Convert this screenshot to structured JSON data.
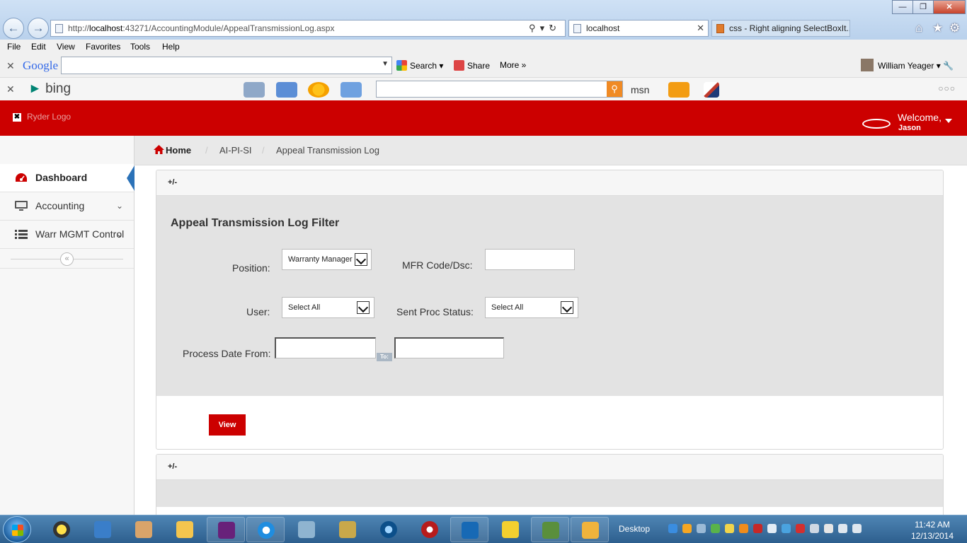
{
  "browser": {
    "address_prefix": "http://",
    "address_host": "localhost",
    "address_rest": ":43271/AccountingModule/AppealTransmissionLog.aspx",
    "tabs": [
      {
        "label": "localhost",
        "active": true
      },
      {
        "label": "css - Right aligning SelectBoxIt...",
        "active": false
      }
    ],
    "menu": [
      "File",
      "Edit",
      "View",
      "Favorites",
      "Tools",
      "Help"
    ],
    "google_toolbar": {
      "logo": "Google",
      "search_label": "Search",
      "share_label": "Share",
      "more_label": "More »",
      "user": "William Yeager ▾"
    },
    "bing_toolbar": {
      "logo": "bing",
      "msn": "msn"
    }
  },
  "header": {
    "logo_alt": "Ryder Logo",
    "welcome": "Welcome,",
    "user": "Jason",
    "brand_color": "#cc0000"
  },
  "sidebar": {
    "items": [
      {
        "label": "Dashboard",
        "icon": "dashboard-gauge-icon",
        "active": true
      },
      {
        "label": "Accounting",
        "icon": "monitor-icon",
        "active": false
      },
      {
        "label": "Warr MGMT Control",
        "icon": "list-icon",
        "active": false
      }
    ],
    "collapse_glyph": "«"
  },
  "breadcrumb": [
    "Home",
    "AI-PI-SI",
    "Appeal Transmission Log"
  ],
  "filter": {
    "toggle": "+/-",
    "title": "Appeal Transmission Log Filter",
    "position_label": "Position:",
    "position_value": "Warranty Manager",
    "mfr_label": "MFR Code/Dsc:",
    "mfr_value": "",
    "user_label": "User:",
    "user_value": "Select All",
    "sent_label": "Sent Proc Status:",
    "sent_value": "Select All",
    "date_label": "Process Date From:",
    "date_to_label": "To:",
    "view_button": "View"
  },
  "panel2": {
    "toggle": "+/-"
  },
  "taskbar": {
    "desktop_label": "Desktop",
    "time": "11:42 AM",
    "date": "12/13/2014"
  }
}
